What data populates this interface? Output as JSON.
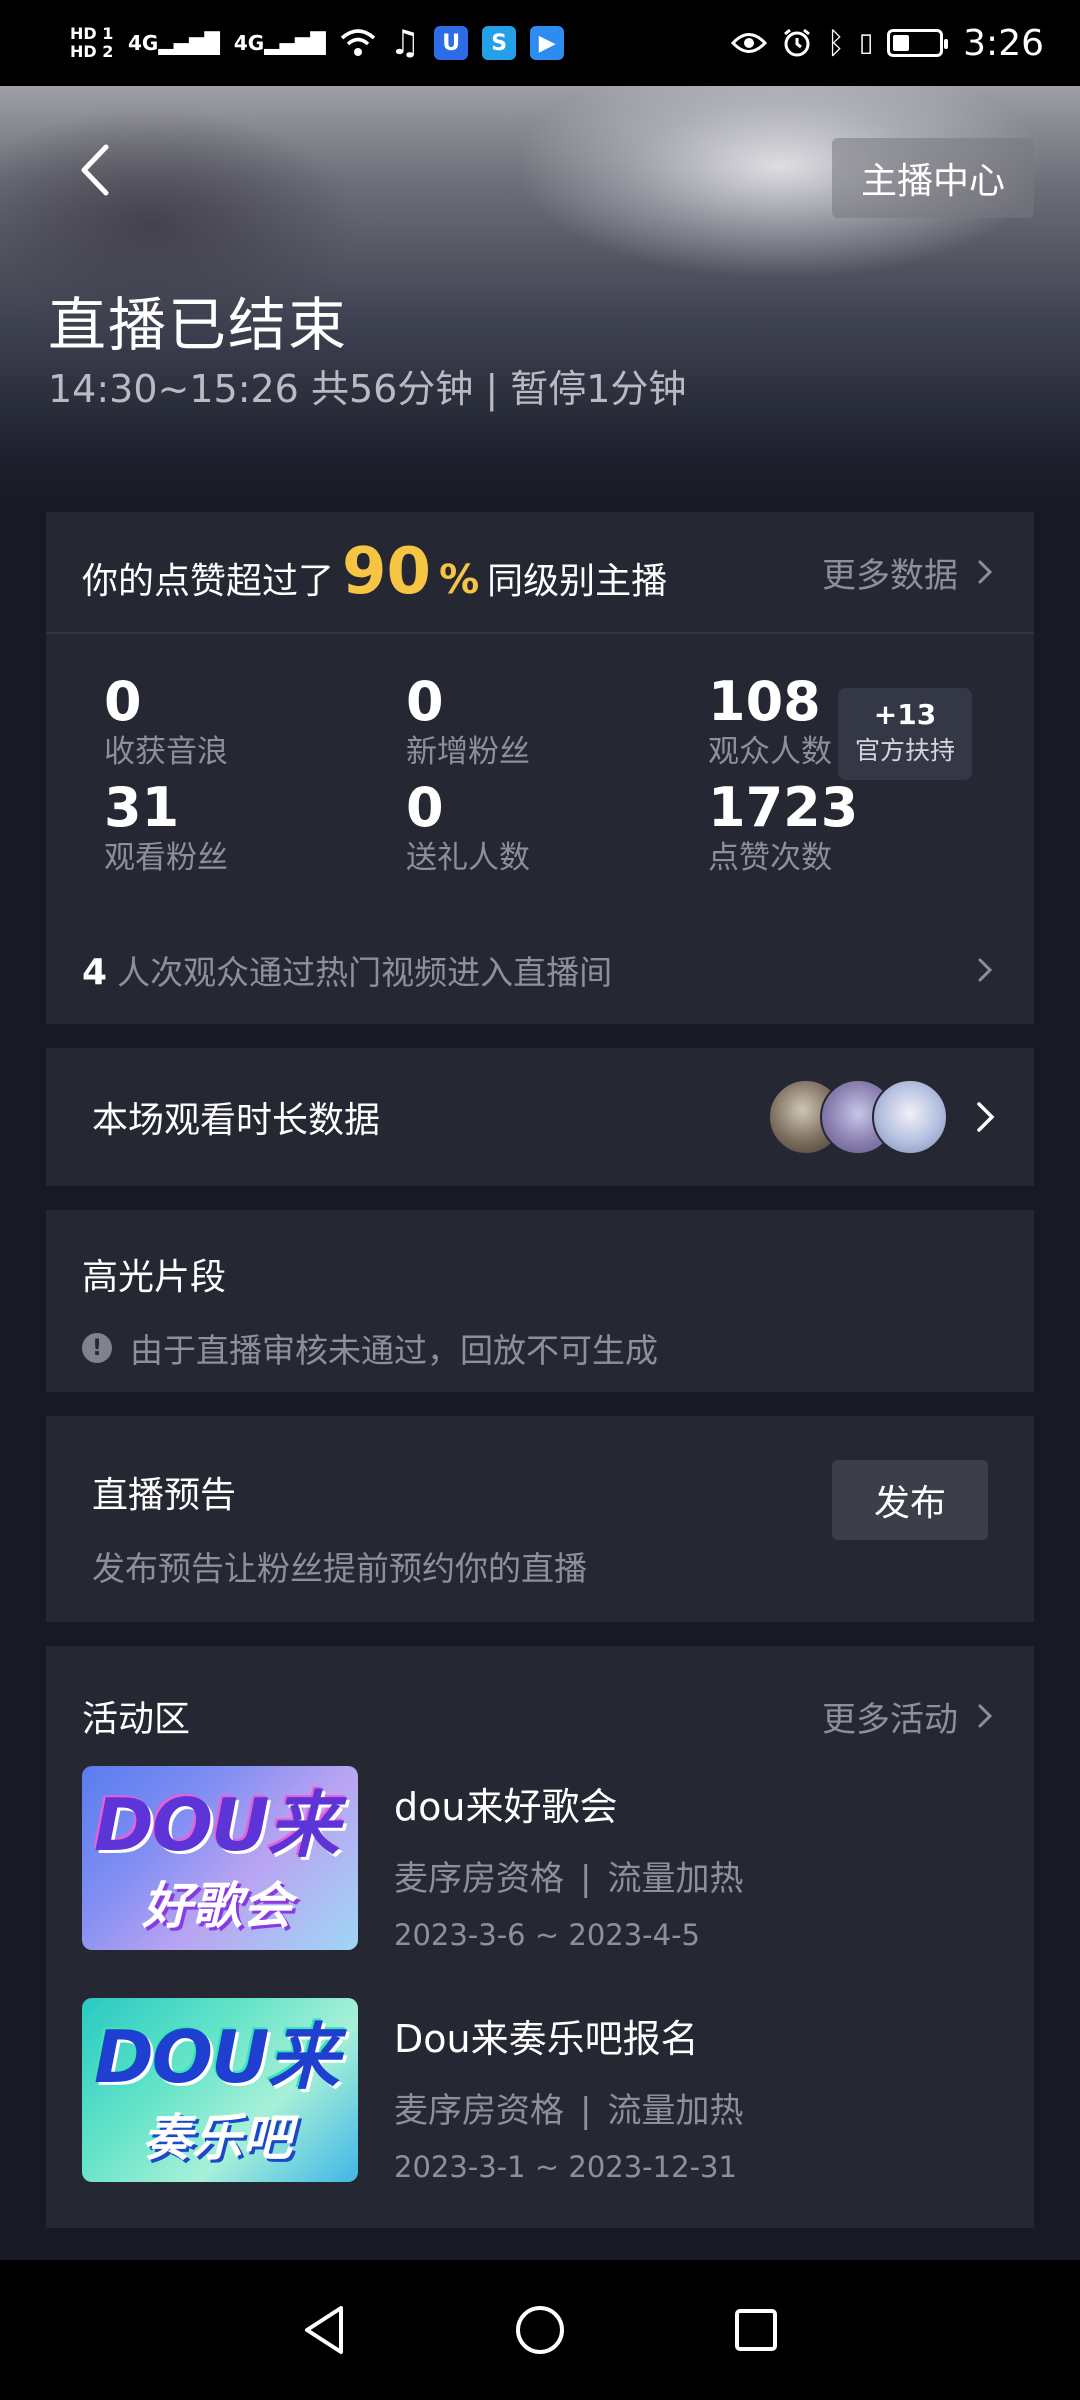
{
  "status_bar": {
    "hd1": "HD 1",
    "hd2": "HD 2",
    "net1": "4G",
    "net2": "4G",
    "time": "3:26"
  },
  "header": {
    "anchor_center": "主播中心",
    "title": "直播已结束",
    "subtitle": "14:30~15:26 共56分钟 | 暂停1分钟"
  },
  "stats": {
    "like_prefix": "你的点赞超过了",
    "like_percent": "90",
    "like_percent_sym": "%",
    "like_suffix": "同级别主播",
    "more_data": "更多数据",
    "items": [
      {
        "value": "0",
        "label": "收获音浪"
      },
      {
        "value": "0",
        "label": "新增粉丝"
      },
      {
        "value": "108",
        "label": "观众人数"
      },
      {
        "value": "31",
        "label": "观看粉丝"
      },
      {
        "value": "0",
        "label": "送礼人数"
      },
      {
        "value": "1723",
        "label": "点赞次数"
      }
    ],
    "support_plus": "+13",
    "support_label": "官方扶持",
    "hot_count": "4",
    "hot_text": "人次观众通过热门视频进入直播间"
  },
  "watch": {
    "title": "本场观看时长数据"
  },
  "highlights": {
    "title": "高光片段",
    "note": "由于直播审核未通过，回放不可生成"
  },
  "preview": {
    "title": "直播预告",
    "subtitle": "发布预告让粉丝提前预约你的直播",
    "button": "发布"
  },
  "activities": {
    "title": "活动区",
    "more": "更多活动",
    "items": [
      {
        "name": "dou来好歌会",
        "tag1": "麦序房资格",
        "sep": "|",
        "tag2": "流量加热",
        "date": "2023-3-6 ~ 2023-4-5",
        "thumb_logo": "DOU来",
        "thumb_sub": "好歌会"
      },
      {
        "name": "Dou来奏乐吧报名",
        "tag1": "麦序房资格",
        "sep": "|",
        "tag2": "流量加热",
        "date": "2023-3-1 ~ 2023-12-31",
        "thumb_logo": "DOU来",
        "thumb_sub": "奏乐吧"
      }
    ]
  },
  "colors": {
    "background": "#171923",
    "card": "#252833",
    "accent_gold": "#f6c543",
    "muted_text": "#8d909b"
  }
}
